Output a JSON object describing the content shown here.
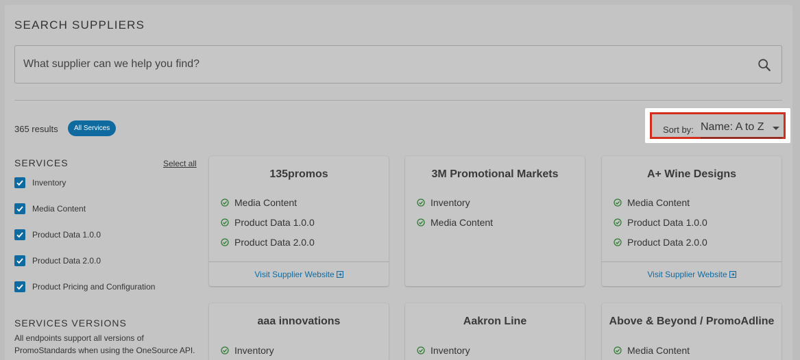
{
  "page": {
    "title": "SEARCH SUPPLIERS"
  },
  "search": {
    "placeholder": "What supplier can we help you find?",
    "value": ""
  },
  "results": {
    "count_text": "365 results",
    "chip_label": "All Services"
  },
  "sort": {
    "label": "Sort by:",
    "value": "Name: A to Z"
  },
  "sidebar": {
    "services_heading": "SERVICES",
    "select_all": "Select all",
    "services": [
      {
        "label": "Inventory",
        "checked": true
      },
      {
        "label": "Media Content",
        "checked": true
      },
      {
        "label": "Product Data 1.0.0",
        "checked": true
      },
      {
        "label": "Product Data 2.0.0",
        "checked": true
      },
      {
        "label": "Product Pricing and Configuration",
        "checked": true
      }
    ],
    "versions_heading": "SERVICES VERSIONS",
    "versions_note": "All endpoints support all versions of PromoStandards when using the OneSource API."
  },
  "suppliers": [
    {
      "name": "135promos",
      "services": [
        "Media Content",
        "Product Data 1.0.0",
        "Product Data 2.0.0"
      ],
      "link": "Visit Supplier Website"
    },
    {
      "name": "3M Promotional Markets",
      "services": [
        "Inventory",
        "Media Content"
      ],
      "link": ""
    },
    {
      "name": "A+ Wine Designs",
      "services": [
        "Media Content",
        "Product Data 1.0.0",
        "Product Data 2.0.0"
      ],
      "link": "Visit Supplier Website"
    },
    {
      "name": "aaa innovations",
      "services": [
        "Inventory"
      ],
      "link": ""
    },
    {
      "name": "Aakron Line",
      "services": [
        "Inventory"
      ],
      "link": ""
    },
    {
      "name": "Above & Beyond / PromoAdline",
      "services": [
        "Media Content"
      ],
      "link": ""
    }
  ],
  "colors": {
    "accent": "#0f6aa0",
    "highlight_border": "#d32f1e",
    "check_green": "#2e7d32"
  },
  "icons": {
    "search": "search-icon",
    "check": "check-circle-icon",
    "external": "external-link-icon",
    "caret": "chevron-down-icon"
  }
}
